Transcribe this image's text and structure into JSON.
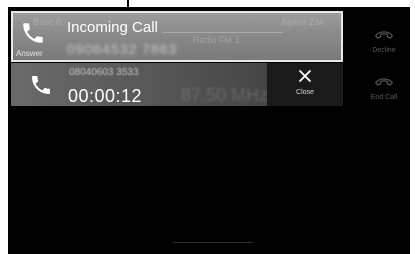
{
  "incoming_call": {
    "title": "Incoming Call",
    "number": "09064532 7863",
    "answer_label": "Answer",
    "background_ghost": {
      "left_text": "Banc 0",
      "center_text": "Radio FM 1",
      "right_text": "Alpine 234"
    }
  },
  "active_call": {
    "number": "08040603 3533",
    "timer": "00:00:12",
    "background_ghost": "87.50 MHz"
  },
  "side_buttons": {
    "decline_label": "Decline",
    "end_call_label": "End Call",
    "close_label": "Close"
  },
  "colors": {
    "screen_bg": "#000000",
    "incoming_bg": "#8a8a8a",
    "incoming_border": "#e8e8e8",
    "active_bg": "#565656",
    "disabled_text": "#5a5a5a"
  },
  "icons": {
    "answer": "phone-handset-icon",
    "active": "phone-handset-icon",
    "close": "close-x-icon",
    "decline": "hang-up-icon",
    "end_call": "hang-up-icon"
  }
}
